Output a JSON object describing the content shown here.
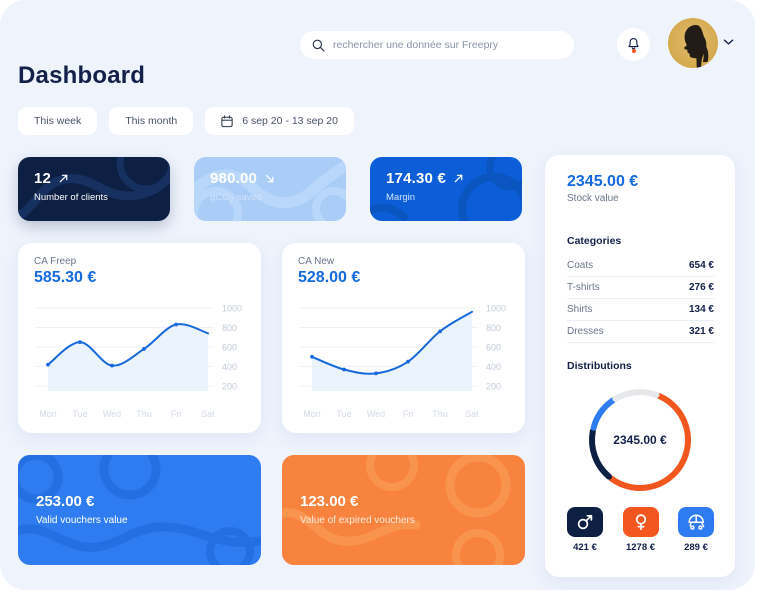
{
  "header": {
    "search": {
      "placeholder": "rechercher une donnée sur Freepry",
      "value": ""
    },
    "search_icon": "search-icon",
    "bell_icon": "bell-icon",
    "avatar_icon": "avatar",
    "chevron_icon": "chevron-down-icon"
  },
  "page_title": "Dashboard",
  "filters": {
    "this_week": "This week",
    "this_month": "This month",
    "date_range": "6 sep 20 - 13 sep 20",
    "calendar_icon": "calendar-icon"
  },
  "stats": [
    {
      "value": "12",
      "label": "Number of clients",
      "trend": "up"
    },
    {
      "value": "980.00",
      "label": "gCO2 saved",
      "label_main": "gCO",
      "label_sub": "2",
      "label_tail": " saved",
      "trend": "down"
    },
    {
      "value": "174.30 €",
      "label": "Margin",
      "trend": "up"
    }
  ],
  "charts": [
    {
      "title": "CA Freep",
      "value": "585.30 €",
      "chart_data": {
        "type": "line",
        "title": "CA Freep",
        "categories": [
          "Mon",
          "Tue",
          "Wed",
          "Thu",
          "Fri",
          "Sat"
        ],
        "values": [
          420,
          650,
          410,
          580,
          830,
          740
        ],
        "ylabel": "",
        "xlabel": "",
        "ylim": [
          200,
          1000
        ],
        "yticks": [
          1000,
          800,
          600,
          400,
          200
        ],
        "grid": true,
        "legend": "none",
        "line_color": "#1668dd",
        "fill_color": "#e8f1fd"
      }
    },
    {
      "title": "CA New",
      "value": "528.00 €",
      "chart_data": {
        "type": "line",
        "title": "CA New",
        "categories": [
          "Mon",
          "Tue",
          "Wed",
          "Fri",
          "Thu",
          "Sat"
        ],
        "values": [
          500,
          370,
          330,
          450,
          760,
          960
        ],
        "ylabel": "",
        "xlabel": "",
        "ylim": [
          200,
          1000
        ],
        "yticks": [
          1000,
          800,
          600,
          400,
          200
        ],
        "grid": true,
        "legend": "none",
        "line_color": "#1668dd",
        "fill_color": "#e8f1fd"
      }
    }
  ],
  "side": {
    "stock_value": "2345.00 €",
    "stock_label": "Stock value",
    "categories_title": "Categories",
    "categories": [
      {
        "name": "Coats",
        "amount": "654 €"
      },
      {
        "name": "T-shirts",
        "amount": "276 €"
      },
      {
        "name": "Shirts",
        "amount": "134 €"
      },
      {
        "name": "Dresses",
        "amount": "321 €"
      }
    ],
    "distributions_title": "Distributions",
    "donut_center": "2345.00 €",
    "chart_data": {
      "type": "pie",
      "title": "Distributions",
      "center_label": "2345.00 €",
      "labels": [
        "Female",
        "Male",
        "Kids",
        "Remaining"
      ],
      "values": [
        1278,
        421,
        289,
        357
      ],
      "colors": [
        "#f4561f",
        "#0d2044",
        "#2f7cf0",
        "#e6e8ec"
      ],
      "legend": "none"
    },
    "badges": [
      {
        "icon": "male-icon",
        "value": "421 €",
        "color": "#0d2044"
      },
      {
        "icon": "female-icon",
        "value": "1278 €",
        "color": "#f4561f"
      },
      {
        "icon": "stroller-icon",
        "value": "289 €",
        "color": "#2f7cf0"
      }
    ]
  },
  "vouchers": [
    {
      "value": "253.00 €",
      "label": "Valid vouchers value",
      "color": "#2f7cf0"
    },
    {
      "value": "123.00 €",
      "label": "Value of expired vouchers",
      "color": "#f8833f"
    }
  ]
}
